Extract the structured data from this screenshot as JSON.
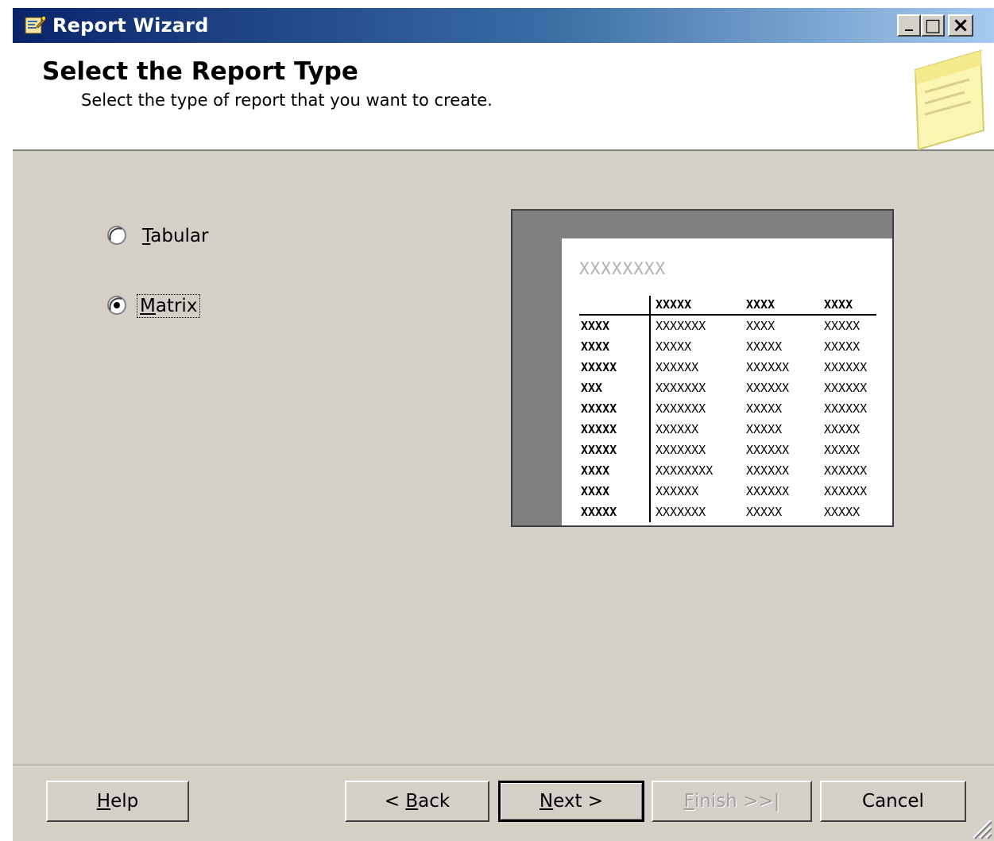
{
  "window": {
    "title": "Report Wizard",
    "controls": {
      "minimize": "_",
      "maximize": "□",
      "close": "×"
    }
  },
  "header": {
    "title": "Select the Report Type",
    "subtitle": "Select the type of report that you want to create."
  },
  "options": [
    {
      "key": "T",
      "rest": "abular",
      "selected": false
    },
    {
      "key": "M",
      "rest": "atrix",
      "selected": true
    }
  ],
  "preview": {
    "title": "XXXXXXXX",
    "columns": [
      "",
      "XXXXX",
      "XXXX",
      "XXXX"
    ],
    "rows": [
      [
        "XXXX",
        "XXXXXXX",
        "XXXX",
        "XXXXX"
      ],
      [
        "XXXX",
        "XXXXX",
        "XXXXX",
        "XXXXX"
      ],
      [
        "XXXXX",
        "XXXXXX",
        "XXXXXX",
        "XXXXXX"
      ],
      [
        "XXX",
        "XXXXXXX",
        "XXXXXX",
        "XXXXXX"
      ],
      [
        "XXXXX",
        "XXXXXXX",
        "XXXXX",
        "XXXXXX"
      ],
      [
        "XXXXX",
        "XXXXXX",
        "XXXXX",
        "XXXXX"
      ],
      [
        "XXXXX",
        "XXXXXXX",
        "XXXXXX",
        "XXXXX"
      ],
      [
        "XXXX",
        "XXXXXXXX",
        "XXXXXX",
        "XXXXXX"
      ],
      [
        "XXXX",
        "XXXXXX",
        "XXXXXX",
        "XXXXXX"
      ],
      [
        "XXXXX",
        "XXXXXXX",
        "XXXXX",
        "XXXXX"
      ]
    ]
  },
  "buttons": {
    "help": {
      "key": "H",
      "rest": "elp"
    },
    "back": {
      "pre": "< ",
      "key": "B",
      "rest": "ack"
    },
    "next": {
      "key": "N",
      "rest": "ext >"
    },
    "finish": {
      "key": "F",
      "rest": "inish >>|",
      "enabled": false
    },
    "cancel": "Cancel"
  }
}
